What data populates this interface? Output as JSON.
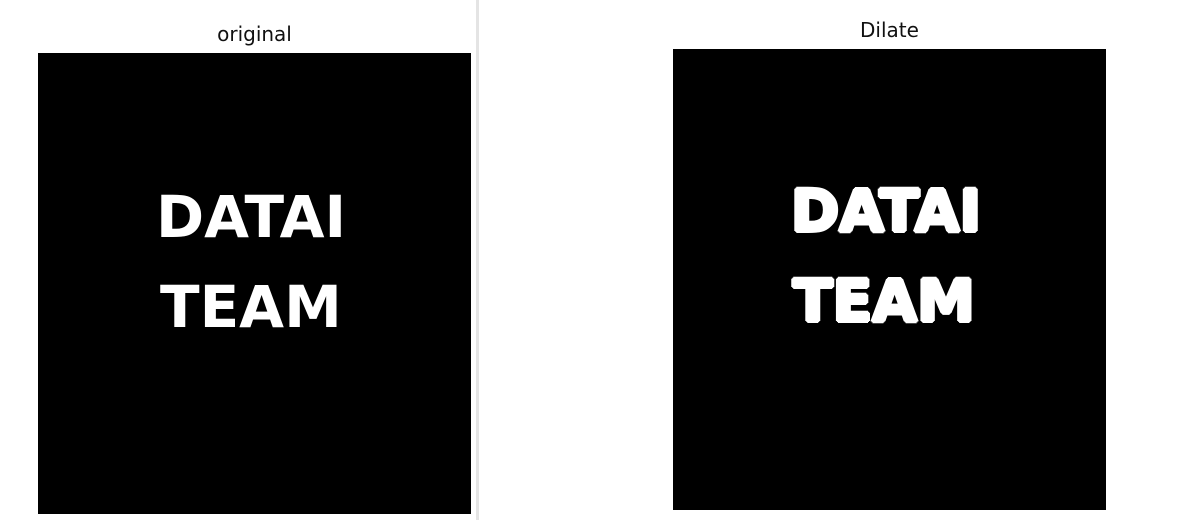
{
  "panels": {
    "original": {
      "title": "original",
      "image_text_line1": "DATAI",
      "image_text_line2": "TEAM"
    },
    "dilate": {
      "title": "Dilate",
      "image_text_line1": "DATAI",
      "image_text_line2": "TEAM"
    }
  },
  "colors": {
    "background": "#ffffff",
    "image_background": "#000000",
    "image_text": "#ffffff"
  }
}
